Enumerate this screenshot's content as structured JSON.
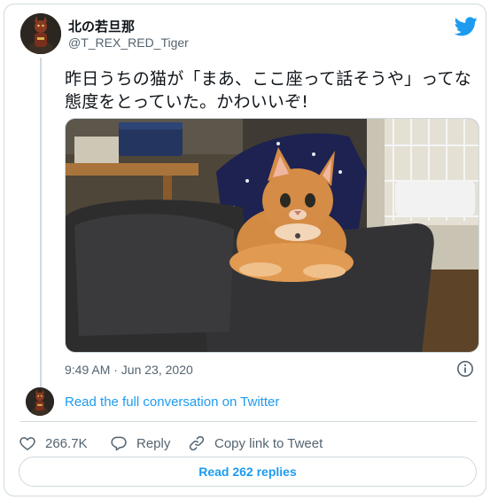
{
  "author": {
    "display_name": "北の若旦那",
    "handle": "@T_REX_RED_Tiger"
  },
  "tweet": {
    "text_line1": "昨日うちの猫が「まあ、ここ座って話そうや」ってな",
    "text_line2": "態度をとっていた。かわいいぞ!",
    "timestamp": "9:49 AM · Jun 23, 2020"
  },
  "conversation_link": "Read the full conversation on Twitter",
  "actions": {
    "likes": "266.7K",
    "reply_label": "Reply",
    "copy_label": "Copy link to Tweet"
  },
  "read_replies_label": "Read 262 replies",
  "colors": {
    "accent": "#1d9bf0",
    "muted": "#536471",
    "border": "#cfd9de"
  },
  "icons": [
    "twitter-bird-icon",
    "info-icon",
    "heart-icon",
    "reply-icon",
    "link-icon"
  ]
}
